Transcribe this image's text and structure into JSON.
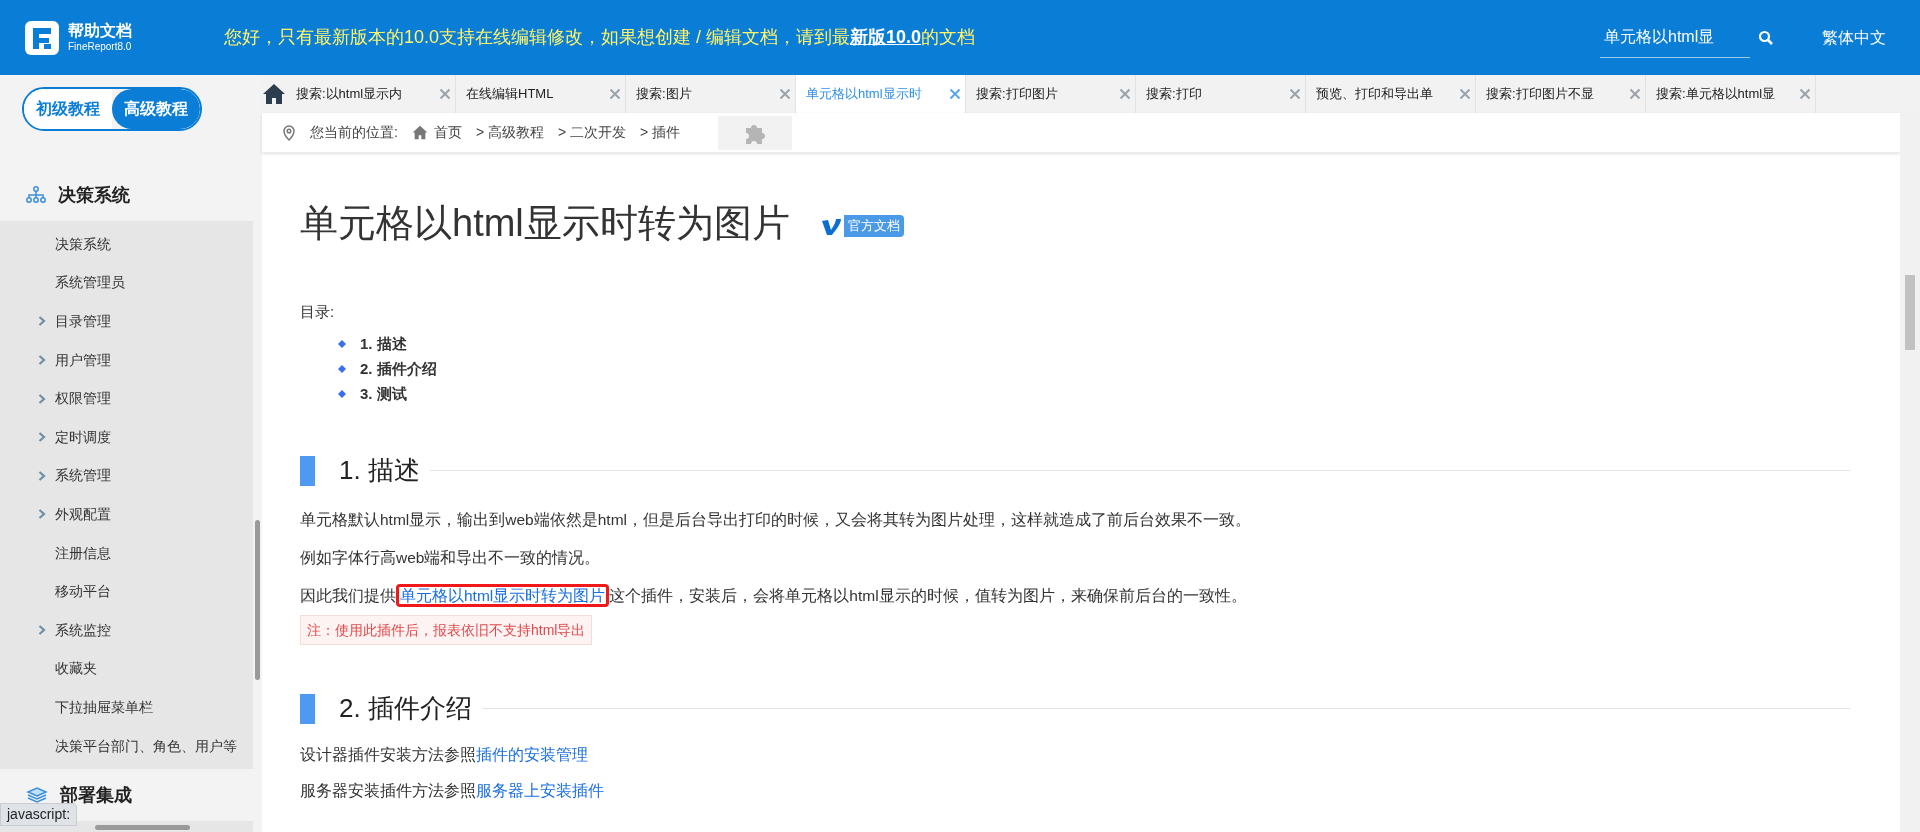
{
  "header": {
    "logo_title": "帮助文档",
    "logo_subtitle": "FineReport8.0",
    "notice": "您好，只有最新版本的10.0支持在线编辑修改，如果想创建 / 编辑文档，请到最**新版10.0**的文档",
    "search": {
      "value": "单元格以html显"
    },
    "language": "繁体中文"
  },
  "sidebar": {
    "toggle": [
      {
        "label": "初级教程",
        "selected": false
      },
      {
        "label": "高级教程",
        "selected": true
      }
    ],
    "categories": [
      {
        "label": "决策系统",
        "expanded": true,
        "children": [
          {
            "label": "决策系统",
            "has_children": false
          },
          {
            "label": "系统管理员",
            "has_children": false
          },
          {
            "label": "目录管理",
            "has_children": true
          },
          {
            "label": "用户管理",
            "has_children": true
          },
          {
            "label": "权限管理",
            "has_children": true
          },
          {
            "label": "定时调度",
            "has_children": true
          },
          {
            "label": "系统管理",
            "has_children": true
          },
          {
            "label": "外观配置",
            "has_children": true
          },
          {
            "label": "注册信息",
            "has_children": false
          },
          {
            "label": "移动平台",
            "has_children": false
          },
          {
            "label": "系统监控",
            "has_children": true
          },
          {
            "label": "收藏夹",
            "has_children": false
          },
          {
            "label": "下拉抽屉菜单栏",
            "has_children": false
          },
          {
            "label": "决策平台部门、角色、用户等",
            "has_children": false
          }
        ]
      },
      {
        "label": "部署集成",
        "expanded": true
      }
    ]
  },
  "tabs": [
    {
      "label": "搜索:以html显示内",
      "selected": false
    },
    {
      "label": "在线编辑HTML",
      "selected": false
    },
    {
      "label": "搜索:图片",
      "selected": false
    },
    {
      "label": "单元格以html显示时",
      "selected": true
    },
    {
      "label": "搜索:打印图片",
      "selected": false
    },
    {
      "label": "搜索:打印",
      "selected": false
    },
    {
      "label": "预览、打印和导出单",
      "selected": false
    },
    {
      "label": "搜索:打印图片不显",
      "selected": false
    },
    {
      "label": "搜索:单元格以html显",
      "selected": false
    }
  ],
  "breadcrumb": {
    "label": "您当前的位置:",
    "items": [
      "首页",
      "> 高级教程",
      "> 二次开发",
      "> 插件"
    ]
  },
  "article": {
    "title": "单元格以html显示时转为图片",
    "badge": "官方文档",
    "toc_label": "目录:",
    "toc": [
      "1. 描述",
      "2. 插件介绍",
      "3. 测试"
    ],
    "sections": [
      {
        "heading": "1. 描述",
        "blocks": [
          {
            "kind": "text",
            "text": "单元格默认html显示，输出到web端依然是html，但是后台导出打印的时候，又会将其转为图片处理，这样就造成了前后台效果不一致。"
          },
          {
            "kind": "text",
            "text": "例如字体行高web端和导出不一致的情况。"
          },
          {
            "kind": "link",
            "before": "因此我们提供",
            "link": "单元格以html显示时转为图片",
            "after": "这个插件，安装后，会将单元格以html显示的时候，值转为图片，来确保前后台的一致性。",
            "highlighted": true
          },
          {
            "kind": "note",
            "text": "注：使用此插件后，报表依旧不支持html导出"
          }
        ]
      },
      {
        "heading": "2. 插件介绍",
        "blocks": [
          {
            "kind": "link",
            "before": "设计器插件安装方法参照",
            "link": "插件的安装管理",
            "highlighted": false
          },
          {
            "kind": "link",
            "before": "服务器安装插件方法参照",
            "link": "服务器上安装插件",
            "highlighted": false
          }
        ]
      }
    ]
  },
  "status_bar": {
    "text": "javascript:"
  }
}
